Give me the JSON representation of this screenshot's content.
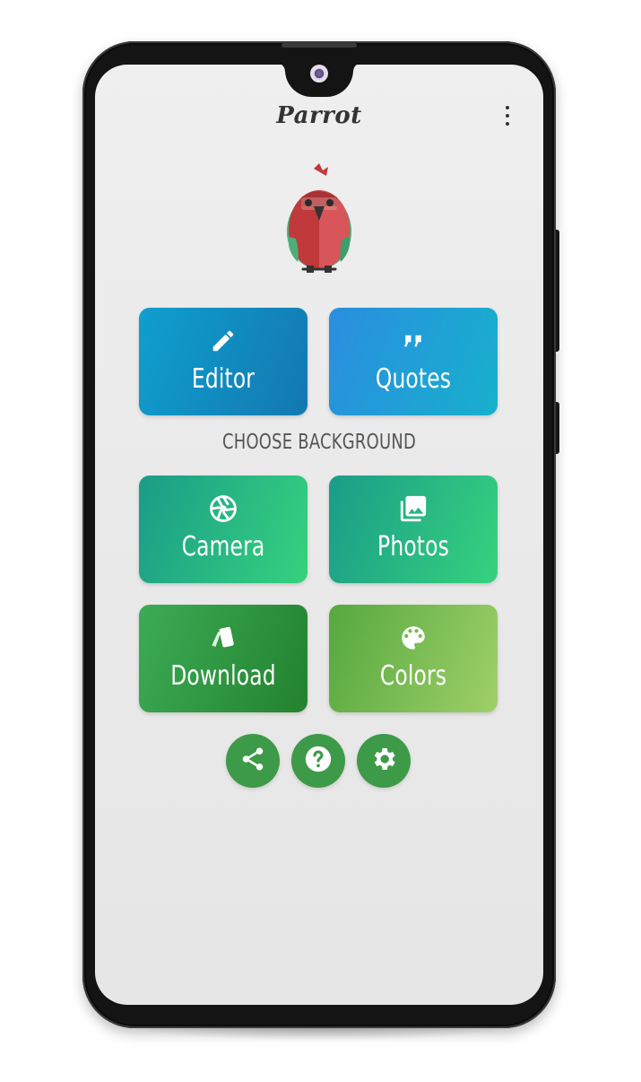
{
  "app": {
    "title": "Parrot"
  },
  "header": {
    "menu_icon": "more-vert-icon"
  },
  "logo": {
    "icon": "parrot-logo"
  },
  "tiles_top": [
    {
      "label": "Editor",
      "icon": "pencil-icon"
    },
    {
      "label": "Quotes",
      "icon": "quote-icon"
    }
  ],
  "section": {
    "heading": "CHOOSE BACKGROUND"
  },
  "tiles_background": [
    {
      "label": "Camera",
      "icon": "camera-aperture-icon"
    },
    {
      "label": "Photos",
      "icon": "photo-library-icon"
    },
    {
      "label": "Download",
      "icon": "cards-icon"
    },
    {
      "label": "Colors",
      "icon": "palette-icon"
    }
  ],
  "actions": [
    {
      "icon": "share-icon"
    },
    {
      "icon": "help-icon"
    },
    {
      "icon": "settings-icon"
    }
  ],
  "colors": {
    "editor": "#1378b0",
    "quotes": "#17b0cc",
    "camera_photos": "#36d27e",
    "download": "#23822e",
    "colors_tile": "#9fd068",
    "action_button": "#3d9a48",
    "parrot_red": "#c0393b",
    "parrot_green": "#4caf7a"
  }
}
